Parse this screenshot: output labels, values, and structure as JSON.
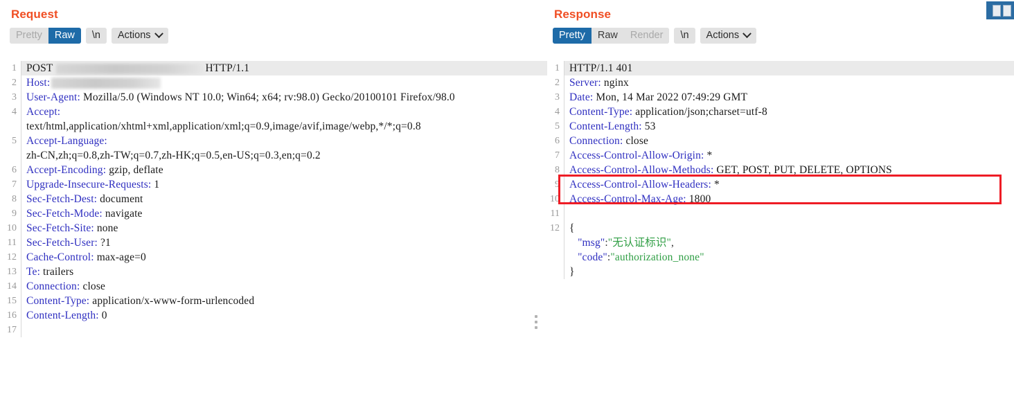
{
  "request": {
    "title": "Request",
    "toolbar": {
      "tabs": [
        {
          "label": "Pretty",
          "state": "inactive-dim"
        },
        {
          "label": "Raw",
          "state": "active"
        }
      ],
      "newline_label": "\\n",
      "actions_label": "Actions"
    },
    "lines": [
      {
        "num": "1",
        "type": "startline",
        "method": "POST",
        "redacted": "url",
        "version": "HTTP/1.1",
        "highlight": true
      },
      {
        "num": "2",
        "type": "header-redacted",
        "name": "Host:",
        "redacted": "host"
      },
      {
        "num": "3",
        "type": "header",
        "name": "User-Agent:",
        "value": " Mozilla/5.0 (Windows NT 10.0; Win64; x64; rv:98.0) Gecko/20100101 Firefox/98.0"
      },
      {
        "num": "4",
        "type": "header",
        "name": "Accept:",
        "value": "\ntext/html,application/xhtml+xml,application/xml;q=0.9,image/avif,image/webp,*/*;q=0.8"
      },
      {
        "num": "5",
        "type": "header",
        "name": "Accept-Language:",
        "value": "\nzh-CN,zh;q=0.8,zh-TW;q=0.7,zh-HK;q=0.5,en-US;q=0.3,en;q=0.2"
      },
      {
        "num": "6",
        "type": "header",
        "name": "Accept-Encoding:",
        "value": " gzip, deflate"
      },
      {
        "num": "7",
        "type": "header",
        "name": "Upgrade-Insecure-Requests:",
        "value": " 1"
      },
      {
        "num": "8",
        "type": "header",
        "name": "Sec-Fetch-Dest:",
        "value": " document"
      },
      {
        "num": "9",
        "type": "header",
        "name": "Sec-Fetch-Mode:",
        "value": " navigate"
      },
      {
        "num": "10",
        "type": "header",
        "name": "Sec-Fetch-Site:",
        "value": " none"
      },
      {
        "num": "11",
        "type": "header",
        "name": "Sec-Fetch-User:",
        "value": " ?1"
      },
      {
        "num": "12",
        "type": "header",
        "name": "Cache-Control:",
        "value": " max-age=0"
      },
      {
        "num": "13",
        "type": "header",
        "name": "Te:",
        "value": " trailers"
      },
      {
        "num": "14",
        "type": "header",
        "name": "Connection:",
        "value": " close"
      },
      {
        "num": "15",
        "type": "header",
        "name": "Content-Type:",
        "value": " application/x-www-form-urlencoded"
      },
      {
        "num": "16",
        "type": "header",
        "name": "Content-Length:",
        "value": " 0"
      },
      {
        "num": "17",
        "type": "blank",
        "name": "",
        "value": ""
      }
    ]
  },
  "response": {
    "title": "Response",
    "toolbar": {
      "tabs": [
        {
          "label": "Pretty",
          "state": "active"
        },
        {
          "label": "Raw",
          "state": "inactive"
        },
        {
          "label": "Render",
          "state": "inactive-dim"
        }
      ],
      "newline_label": "\\n",
      "actions_label": "Actions"
    },
    "lines": [
      {
        "num": "1",
        "type": "statusline",
        "value": "HTTP/1.1 401",
        "highlight": true
      },
      {
        "num": "2",
        "type": "header",
        "name": "Server:",
        "value": " nginx"
      },
      {
        "num": "3",
        "type": "header",
        "name": "Date:",
        "value": " Mon, 14 Mar 2022 07:49:29 GMT"
      },
      {
        "num": "4",
        "type": "header",
        "name": "Content-Type:",
        "value": " application/json;charset=utf-8"
      },
      {
        "num": "5",
        "type": "header",
        "name": "Content-Length:",
        "value": " 53"
      },
      {
        "num": "6",
        "type": "header",
        "name": "Connection:",
        "value": " close"
      },
      {
        "num": "7",
        "type": "header",
        "name": "Access-Control-Allow-Origin:",
        "value": " *"
      },
      {
        "num": "8",
        "type": "header",
        "name": "Access-Control-Allow-Methods:",
        "value": " GET, POST, PUT, DELETE, OPTIONS"
      },
      {
        "num": "9",
        "type": "header",
        "name": "Access-Control-Allow-Headers:",
        "value": " *"
      },
      {
        "num": "10",
        "type": "header",
        "name": "Access-Control-Max-Age:",
        "value": " 1800"
      },
      {
        "num": "11",
        "type": "blank",
        "name": "",
        "value": ""
      },
      {
        "num": "12",
        "type": "json-open",
        "value": "{"
      },
      {
        "num": "",
        "type": "json-pair",
        "key": "\"msg\"",
        "sep": ":",
        "val": "\"无认证标识\"",
        "tail": ","
      },
      {
        "num": "",
        "type": "json-pair",
        "key": "\"code\"",
        "sep": ":",
        "val": "\"authorization_none\"",
        "tail": ""
      },
      {
        "num": "",
        "type": "json-close",
        "value": "}"
      }
    ]
  },
  "annotation": {
    "name": "red-highlight-box",
    "color": "#ee1c25",
    "targets": "Access-Control-Allow-Origin / Allow-Methods / Allow-Headers"
  },
  "icons": {
    "layout_toggle": "split-pane-layout-icon",
    "drag_handle": "vertical-dots-drag-handle"
  },
  "colors": {
    "heading": "#f04e23",
    "tab_active_bg": "#1e6ba8",
    "toolbar_bg": "#e2e2e2",
    "header_name": "#2e2ec0",
    "json_value": "#2f9e44",
    "annotation": "#ee1c25"
  }
}
